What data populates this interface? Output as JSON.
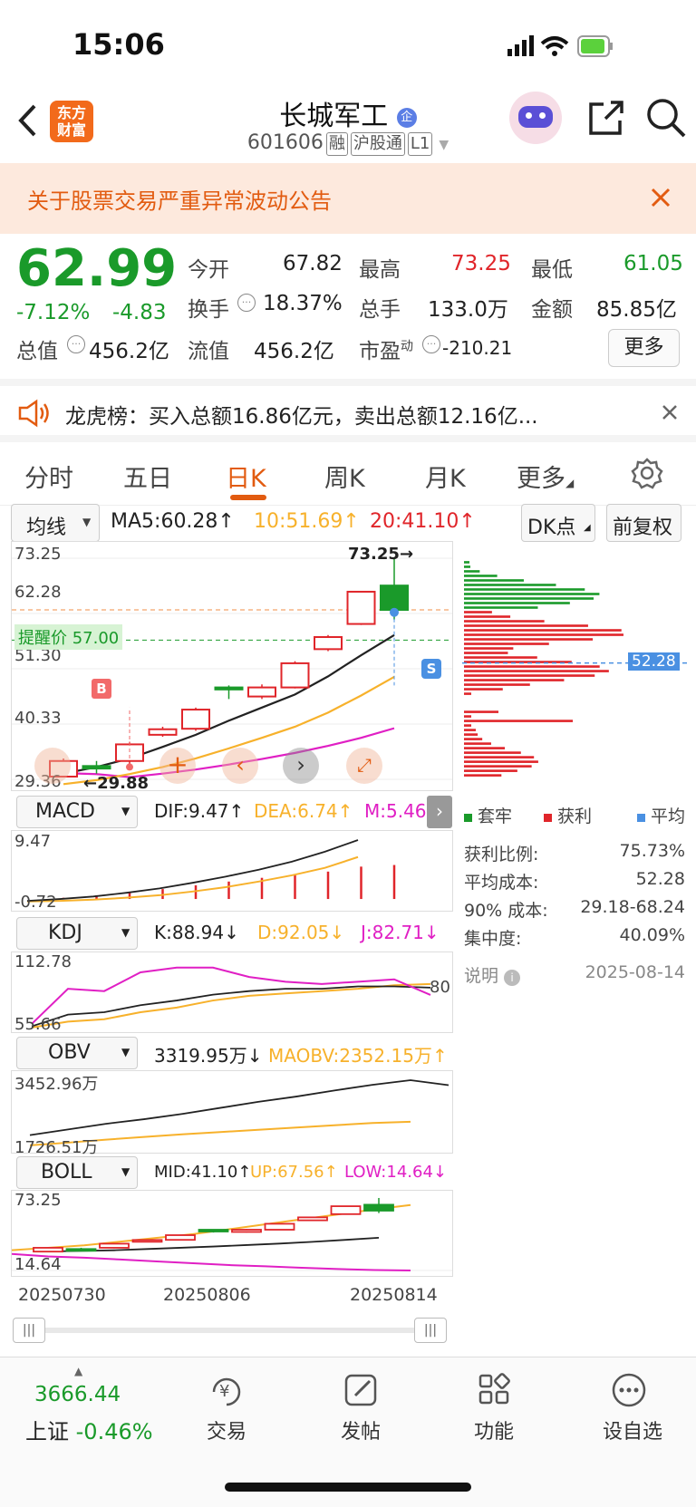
{
  "status": {
    "time": "15:06"
  },
  "header": {
    "title": "长城军工",
    "code": "601606",
    "tags": [
      "融",
      "沪股通",
      "L1"
    ],
    "logo_line1": "东方",
    "logo_line2": "财富"
  },
  "notice": {
    "text": "关于股票交易严重异常波动公告"
  },
  "quote": {
    "price": "62.99",
    "change_pct": "-7.12%",
    "change": "-4.83",
    "open_label": "今开",
    "open": "67.82",
    "high_label": "最高",
    "high": "73.25",
    "low_label": "最低",
    "low": "61.05",
    "turnover_label": "换手",
    "turnover": "18.37%",
    "volume_label": "总手",
    "volume": "133.0万",
    "amount_label": "金额",
    "amount": "85.85亿",
    "mcap_label": "总值",
    "mcap": "456.2亿",
    "float_label": "流值",
    "float": "456.2亿",
    "pe_label": "市盈",
    "pe_sup": "动",
    "pe": "-210.21",
    "more": "更多"
  },
  "lhb": {
    "text": "龙虎榜：买入总额16.86亿元，卖出总额12.16亿..."
  },
  "tabs": [
    "分时",
    "五日",
    "日K",
    "周K",
    "月K",
    "更多"
  ],
  "ma_bar": {
    "selector": "均线",
    "ma5": "MA5:60.28",
    "ma10": "10:51.69",
    "ma20": "20:41.10",
    "dk": "DK点",
    "fq": "前复权"
  },
  "kline": {
    "y_labels": [
      "73.25",
      "62.28",
      "51.30",
      "40.33",
      "29.36"
    ],
    "high_mark": "73.25",
    "low_mark": "29.88",
    "alert": "提醒价 57.00",
    "buy": "B",
    "sell": "S",
    "candles": [
      {
        "o": 29.9,
        "c": 33.0,
        "h": 33.5,
        "l": 29.88
      },
      {
        "o": 32.0,
        "c": 31.5,
        "h": 33.0,
        "l": 30.5
      },
      {
        "o": 33.0,
        "c": 36.3,
        "h": 36.8,
        "l": 32.5
      },
      {
        "o": 38.2,
        "c": 39.3,
        "h": 39.8,
        "l": 37.8
      },
      {
        "o": 39.4,
        "c": 43.2,
        "h": 43.6,
        "l": 39.0
      },
      {
        "o": 47.6,
        "c": 47.2,
        "h": 48.0,
        "l": 45.3
      },
      {
        "o": 45.8,
        "c": 47.6,
        "h": 48.2,
        "l": 45.3
      },
      {
        "o": 47.6,
        "c": 52.4,
        "h": 52.8,
        "l": 47.4
      },
      {
        "o": 55.2,
        "c": 57.6,
        "h": 58.0,
        "l": 54.8
      },
      {
        "o": 60.2,
        "c": 66.6,
        "h": 66.6,
        "l": 60.0
      },
      {
        "o": 67.82,
        "c": 62.99,
        "h": 73.25,
        "l": 61.05
      }
    ],
    "ma5": [
      30.5,
      31.8,
      33.5,
      35.8,
      38.2,
      41.0,
      43.6,
      46.2,
      49.8,
      54.0,
      58.0
    ],
    "ma10": [
      28.4,
      29.2,
      30.4,
      31.8,
      33.5,
      35.5,
      37.6,
      39.8,
      42.6,
      46.0,
      49.7
    ],
    "ma20": [
      29.0,
      29.3,
      29.8,
      30.5,
      31.3,
      32.3,
      33.4,
      34.6,
      36.0,
      37.6,
      39.5
    ]
  },
  "chip": {
    "price_tag": "52.28",
    "legend": [
      "套牢",
      "获利",
      "平均"
    ],
    "rows": [
      {
        "k": "获利比例:",
        "v": "75.73%"
      },
      {
        "k": "平均成本:",
        "v": "52.28"
      },
      {
        "k": "90% 成本:",
        "v": "29.18-68.24"
      },
      {
        "k": "集中度:",
        "v": "40.09%"
      },
      {
        "k": "说明",
        "v": "2025-08-14"
      }
    ]
  },
  "macd": {
    "sel": "MACD",
    "dif": "DIF:9.47",
    "dea": "DEA:6.74",
    "m": "M:5.46",
    "y_top": "9.47",
    "y_bot": "-0.72"
  },
  "kdj": {
    "sel": "KDJ",
    "k": "K:88.94",
    "d": "D:92.05",
    "j": "J:82.71",
    "y_top": "112.78",
    "y_bot": "55.66",
    "mark": "80"
  },
  "obv": {
    "sel": "OBV",
    "obv": "3319.95万",
    "maobv": "MAOBV:2352.15万",
    "y_top": "3452.96万",
    "y_bot": "1726.51万"
  },
  "boll": {
    "sel": "BOLL",
    "mid": "MID:41.10",
    "up": "UP:67.56",
    "low": "LOW:14.64",
    "y_top": "73.25",
    "y_bot": "14.64"
  },
  "xaxis": [
    "20250730",
    "20250806",
    "20250814"
  ],
  "bottom": {
    "index_val": "3666.44",
    "index_name": "上证",
    "index_pct": "-0.46%",
    "items": [
      "交易",
      "发帖",
      "功能",
      "设自选"
    ]
  },
  "colors": {
    "up": "#e0252a",
    "down": "#1a9a2a",
    "ma5": "#222222",
    "ma10": "#f7b12b",
    "ma20": "#e01fc4",
    "accent": "#e25b10"
  }
}
